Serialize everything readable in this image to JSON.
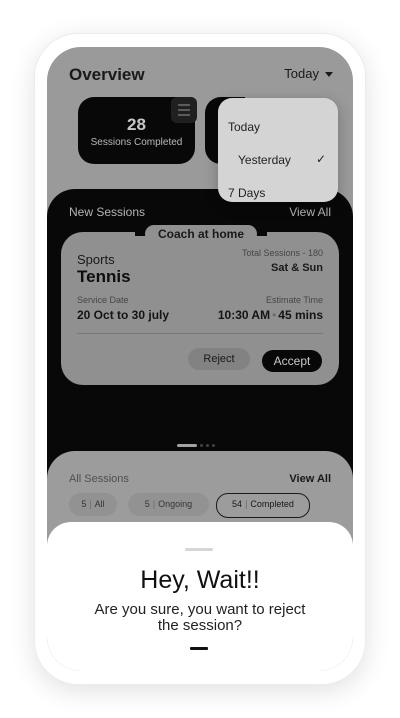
{
  "overview": {
    "title": "Overview",
    "period_selected": "Today"
  },
  "stats": {
    "count": "28",
    "label": "Sessions Completed"
  },
  "dropdown": {
    "options": [
      "Today",
      "Yesterday",
      "7 Days"
    ],
    "checked": "Yesterday"
  },
  "new_sessions": {
    "title": "New Sessions",
    "view_all": "View All",
    "card": {
      "tag": "Coach at home",
      "category": "Sports",
      "name": "Tennis",
      "total_sessions": "Total Sessions - 180",
      "days": "Sat & Sun",
      "service_date_label": "Service Date",
      "service_date": "20 Oct to 30 july",
      "estimate_label": "Estimate Time",
      "time": "10:30 AM",
      "duration": "45 mins",
      "reject": "Reject",
      "accept": "Accept"
    }
  },
  "all_sessions": {
    "title": "All Sessions",
    "view_all": "View All",
    "chips": [
      {
        "count": "5",
        "label": "All"
      },
      {
        "count": "5",
        "label": "Ongoing"
      },
      {
        "count": "54",
        "label": "Completed"
      }
    ]
  },
  "sheet": {
    "title": "Hey, Wait!!",
    "message": "Are you sure, you want to reject the session?"
  },
  "colors": {
    "accent": "#0b0b0b",
    "overlay": "#c6c6c6",
    "sheet": "#ffffff"
  }
}
